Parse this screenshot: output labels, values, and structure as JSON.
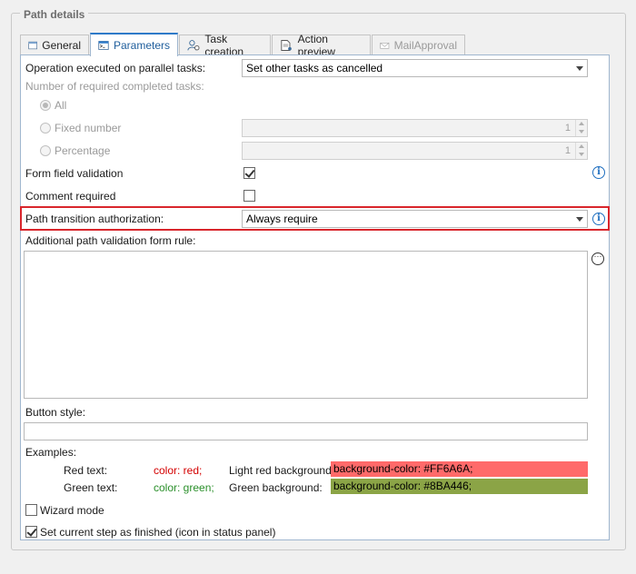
{
  "group_title": "Path details",
  "tabs": [
    {
      "label": "General",
      "icon": "window-icon"
    },
    {
      "label": "Parameters",
      "icon": "console-icon"
    },
    {
      "label": "Task creation",
      "icon": "user-gear-icon"
    },
    {
      "label": "Action preview",
      "icon": "document-eye-icon"
    },
    {
      "label": "MailApproval",
      "icon": "mail-icon"
    }
  ],
  "operation": {
    "label": "Operation executed on parallel tasks:",
    "value": "Set other tasks as cancelled"
  },
  "required": {
    "label": "Number of required completed tasks:",
    "options": [
      "All",
      "Fixed number",
      "Percentage"
    ],
    "fixed_value": "1",
    "percent_value": "1"
  },
  "form_validation": {
    "label": "Form field validation",
    "checked": true
  },
  "comment_required": {
    "label": "Comment required",
    "checked": false
  },
  "authorization": {
    "label": "Path transition authorization:",
    "value": "Always require"
  },
  "rule": {
    "label": "Additional path validation form rule:",
    "ellipsis": "···"
  },
  "button_style": {
    "label": "Button style:"
  },
  "examples": {
    "label": "Examples:",
    "red_text_label": "Red text:",
    "red_text_code": "color: red;",
    "light_red_label": "Light red background:",
    "light_red_code": "background-color: #FF6A6A;",
    "green_text_label": "Green text:",
    "green_text_code": "color: green;",
    "green_bg_label": "Green background:",
    "green_bg_code": "background-color: #8BA446;",
    "colors": {
      "red": "#d40000",
      "green": "#2a8f2a",
      "light_red_bg": "#FF6A6A",
      "green_bg": "#8BA446"
    }
  },
  "wizard_mode": {
    "label": "Wizard mode",
    "checked": false
  },
  "finished": {
    "label": "Set current step as finished (icon in status panel)",
    "checked": true
  },
  "info_glyph": "i",
  "accent": "#2e7ac8",
  "highlight_color": "#d9262c"
}
